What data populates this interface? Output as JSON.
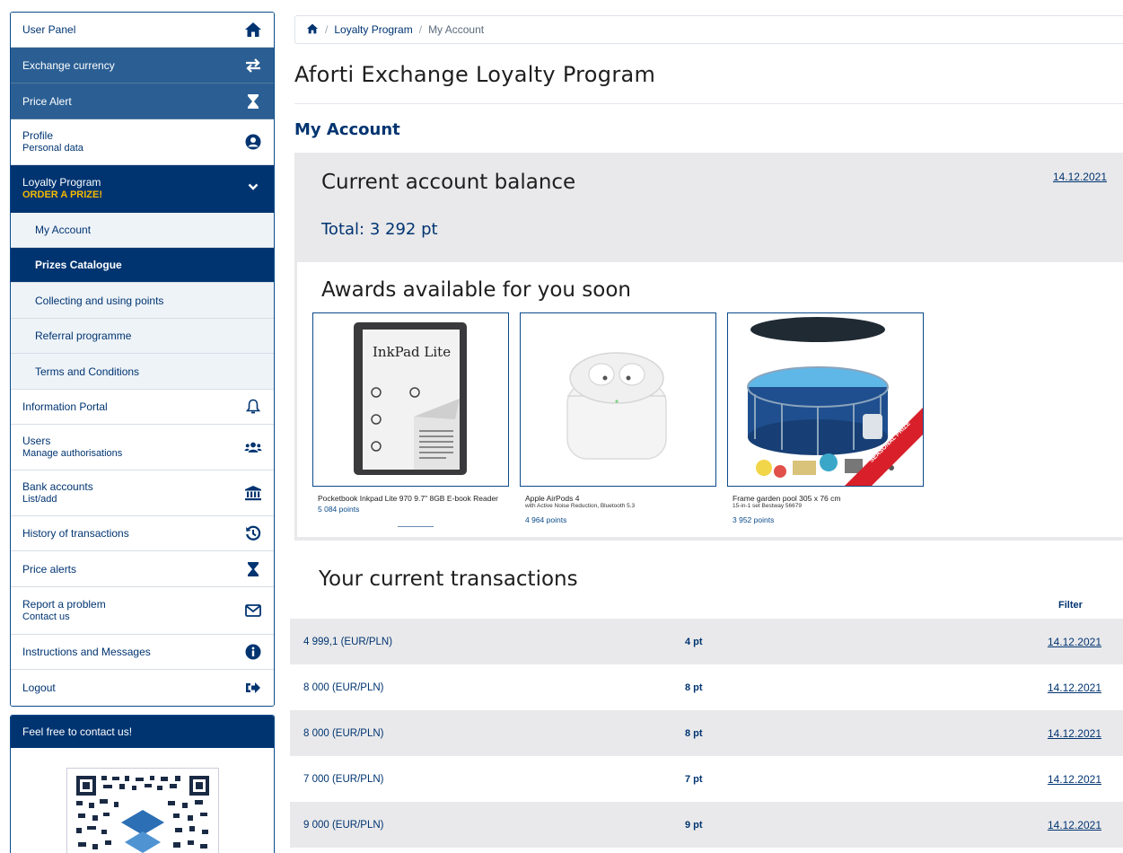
{
  "colors": {
    "brand_dark": "#003471",
    "brand_mid": "#2b5f94",
    "accent_yellow": "#f5b800",
    "panel_gray": "#e9e9eb"
  },
  "sidebar": {
    "items": [
      {
        "label": "User Panel",
        "icon": "home-icon"
      },
      {
        "label": "Exchange currency",
        "icon": "exchange-icon"
      },
      {
        "label": "Price Alert",
        "icon": "hourglass-icon"
      },
      {
        "label": "Profile",
        "sub": "Personal data",
        "icon": "user-circle-icon"
      },
      {
        "label": "Loyalty Program",
        "sub": "ORDER A PRIZE!",
        "icon": "chevron-down-icon"
      },
      {
        "label": "My Account"
      },
      {
        "label": "Prizes Catalogue"
      },
      {
        "label": "Collecting and using points"
      },
      {
        "label": "Referral programme"
      },
      {
        "label": "Terms and Conditions"
      },
      {
        "label": "Information Portal",
        "icon": "bell-icon"
      },
      {
        "label": "Users",
        "sub": "Manage authorisations",
        "icon": "users-icon"
      },
      {
        "label": "Bank accounts",
        "sub": "List/add",
        "icon": "bank-icon"
      },
      {
        "label": "History of transactions",
        "icon": "history-icon"
      },
      {
        "label": "Price alerts",
        "icon": "hourglass-icon"
      },
      {
        "label": "Report a problem",
        "sub": "Contact us",
        "icon": "envelope-icon"
      },
      {
        "label": "Instructions and Messages",
        "icon": "info-icon"
      },
      {
        "label": "Logout",
        "icon": "logout-icon"
      }
    ]
  },
  "contact": {
    "title": "Feel free to contact us!"
  },
  "breadcrumb": {
    "home_icon": "home-icon",
    "items": [
      "Loyalty Program",
      "My Account"
    ]
  },
  "page": {
    "title": "Aforti Exchange Loyalty Program",
    "section": "My Account"
  },
  "balance": {
    "title": "Current account balance",
    "date": "14.12.2021",
    "total": "Total: 3 292  pt"
  },
  "awards": {
    "title": "Awards available for you soon",
    "items": [
      {
        "name": "Pocketbook Inkpad Lite 970 9.7\" 8GB E-book Reader",
        "desc": "",
        "points": "5 084 points",
        "image_text": "InkPad Lite"
      },
      {
        "name": "Apple AirPods 4",
        "desc": "with Active Noise Reduction, Bluetooth 5.3",
        "points": "4 964 points",
        "image_text": ""
      },
      {
        "name": "Frame garden pool 305 x 76 cm",
        "desc": "15-in-1 set Bestway 56679",
        "points": "3 952 points",
        "image_text": "SEASONAL PRIZE"
      }
    ]
  },
  "transactions": {
    "title": "Your current transactions",
    "filter_label": "Filter",
    "rows": [
      {
        "amount": "4 999,1 (EUR/PLN)",
        "points": "4 pt",
        "date": "14.12.2021"
      },
      {
        "amount": "8 000 (EUR/PLN)",
        "points": "8 pt",
        "date": "14.12.2021"
      },
      {
        "amount": "8 000 (EUR/PLN)",
        "points": "8 pt",
        "date": "14.12.2021"
      },
      {
        "amount": "7 000 (EUR/PLN)",
        "points": "7 pt",
        "date": "14.12.2021"
      },
      {
        "amount": "9 000 (EUR/PLN)",
        "points": "9 pt",
        "date": "14.12.2021"
      }
    ]
  }
}
